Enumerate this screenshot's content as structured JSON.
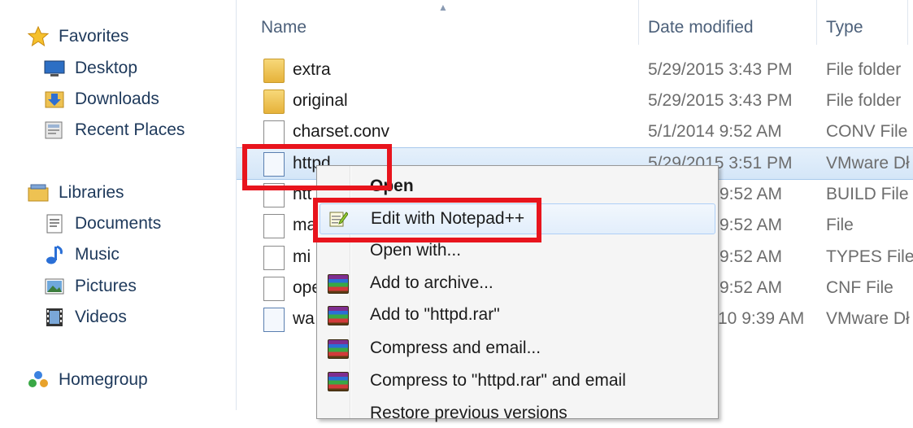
{
  "nav": {
    "favorites": {
      "label": "Favorites",
      "icon": "star-icon"
    },
    "favorite_items": [
      {
        "label": "Desktop",
        "icon": "desktop-icon"
      },
      {
        "label": "Downloads",
        "icon": "downloads-folder-icon"
      },
      {
        "label": "Recent Places",
        "icon": "recent-places-icon"
      }
    ],
    "libraries": {
      "label": "Libraries",
      "icon": "libraries-icon"
    },
    "library_items": [
      {
        "label": "Documents",
        "icon": "documents-icon"
      },
      {
        "label": "Music",
        "icon": "music-icon"
      },
      {
        "label": "Pictures",
        "icon": "pictures-icon"
      },
      {
        "label": "Videos",
        "icon": "videos-icon"
      }
    ],
    "homegroup": {
      "label": "Homegroup",
      "icon": "homegroup-icon"
    }
  },
  "list": {
    "columns": {
      "name": "Name",
      "date": "Date modified",
      "type": "Type"
    },
    "sort_indicator": "▲",
    "rows": [
      {
        "name": "extra",
        "date": "5/29/2015 3:43 PM",
        "type": "File folder",
        "icon": "folder-icon"
      },
      {
        "name": "original",
        "date": "5/29/2015 3:43 PM",
        "type": "File folder",
        "icon": "folder-icon"
      },
      {
        "name": "charset.conv",
        "date": "5/1/2014 9:52 AM",
        "type": "CONV File",
        "icon": "file-icon"
      },
      {
        "name": "httpd",
        "date": "5/29/2015 3:51 PM",
        "type": "VMware Dł",
        "icon": "config-file-icon"
      },
      {
        "name": "htt",
        "date": "9:52 AM",
        "type": "BUILD File",
        "icon": "file-icon"
      },
      {
        "name": "ma",
        "date": "9:52 AM",
        "type": "File",
        "icon": "file-icon"
      },
      {
        "name": "mi",
        "date": "9:52 AM",
        "type": "TYPES File",
        "icon": "file-icon"
      },
      {
        "name": "ope",
        "date": "9:52 AM",
        "type": "CNF File",
        "icon": "file-icon"
      },
      {
        "name": "wa",
        "date": "10 9:39 AM",
        "type": "VMware Dł",
        "icon": "config-file-icon"
      }
    ]
  },
  "context_menu": {
    "items": [
      {
        "label": "Open",
        "bold": true,
        "icon": ""
      },
      {
        "label": "Edit with Notepad++",
        "icon": "notepad-plus-plus-icon"
      },
      {
        "label": "Open with...",
        "icon": ""
      },
      {
        "label": "Add to archive...",
        "icon": "winrar-icon"
      },
      {
        "label": "Add to \"httpd.rar\"",
        "icon": "winrar-icon"
      },
      {
        "label": "Compress and email...",
        "icon": "winrar-icon"
      },
      {
        "label": "Compress to \"httpd.rar\" and email",
        "icon": "winrar-icon"
      },
      {
        "label": "Restore previous versions",
        "icon": ""
      }
    ]
  },
  "colors": {
    "highlight_red": "#e8141d",
    "selection_blue": "#d4e6f8"
  }
}
